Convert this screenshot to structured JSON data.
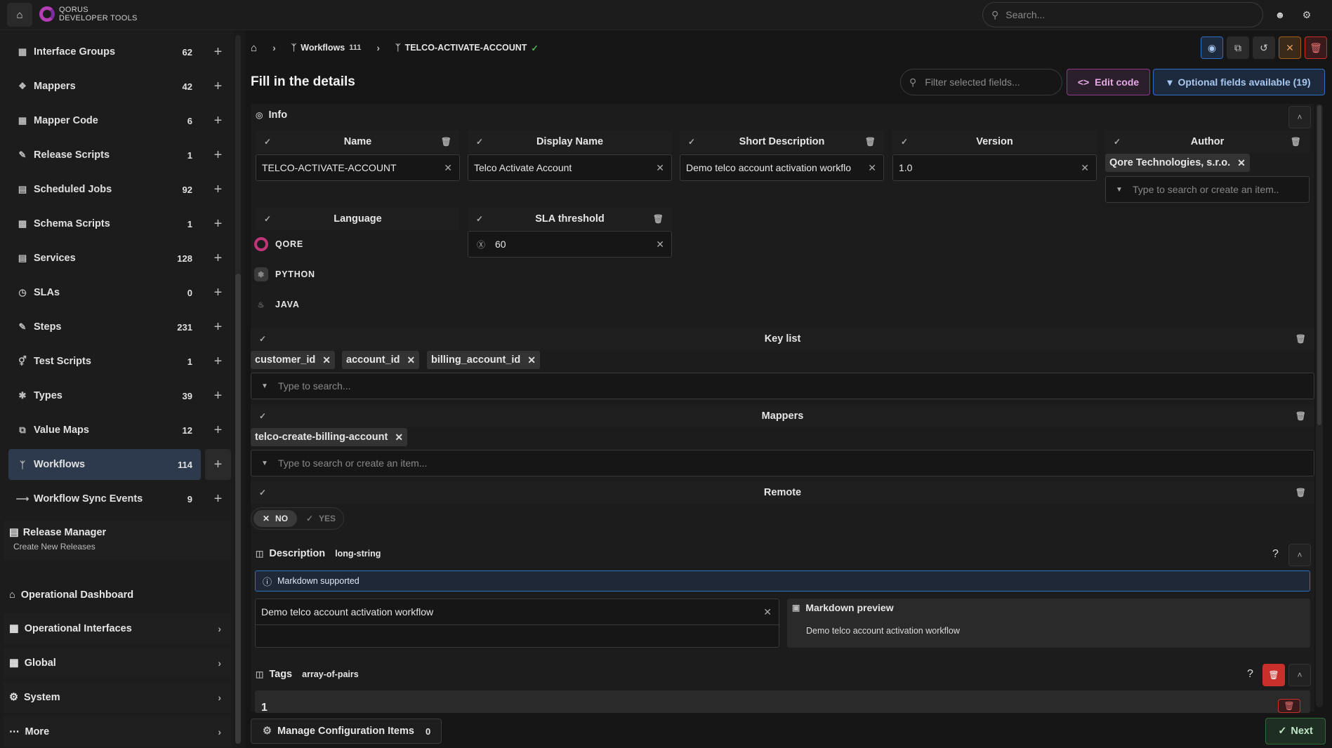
{
  "brand": {
    "line1": "QORUS",
    "line2": "DEVELOPER TOOLS"
  },
  "search": {
    "placeholder": "Search..."
  },
  "sidebar": {
    "items": [
      {
        "label": "Interface Groups",
        "count": "62"
      },
      {
        "label": "Mappers",
        "count": "42"
      },
      {
        "label": "Mapper Code",
        "count": "6"
      },
      {
        "label": "Release Scripts",
        "count": "1"
      },
      {
        "label": "Scheduled Jobs",
        "count": "92"
      },
      {
        "label": "Schema Scripts",
        "count": "1"
      },
      {
        "label": "Services",
        "count": "128"
      },
      {
        "label": "SLAs",
        "count": "0"
      },
      {
        "label": "Steps",
        "count": "231"
      },
      {
        "label": "Test Scripts",
        "count": "1"
      },
      {
        "label": "Types",
        "count": "39"
      },
      {
        "label": "Value Maps",
        "count": "12"
      },
      {
        "label": "Workflows",
        "count": "114"
      },
      {
        "label": "Workflow Sync Events",
        "count": "9"
      }
    ],
    "release_manager": {
      "title": "Release Manager",
      "subtitle": "Create New Releases"
    },
    "sections": [
      "Operational Dashboard",
      "Operational Interfaces",
      "Global",
      "System",
      "More"
    ]
  },
  "breadcrumb": {
    "section": "Workflows",
    "section_count": "111",
    "current": "TELCO-ACTIVATE-ACCOUNT"
  },
  "page": {
    "title": "Fill in the details"
  },
  "toolbar": {
    "filter_placeholder": "Filter selected fields...",
    "edit_code": "Edit code",
    "optional_fields": "Optional fields available (19)"
  },
  "info": {
    "title": "Info",
    "fields": {
      "name_label": "Name",
      "name_value": "TELCO-ACTIVATE-ACCOUNT",
      "display_label": "Display Name",
      "display_value": "Telco Activate Account",
      "short_label": "Short Description",
      "short_value": "Demo telco account activation workflo",
      "version_label": "Version",
      "version_value": "1.0",
      "author_label": "Author",
      "author_tag": "Qore Technologies, s.r.o.",
      "author_placeholder": "Type to search or create an item..",
      "language_label": "Language",
      "languages": [
        "QORE",
        "PYTHON",
        "JAVA"
      ],
      "sla_label": "SLA threshold",
      "sla_value": "60"
    }
  },
  "keylist": {
    "label": "Key list",
    "tags": [
      "customer_id",
      "account_id",
      "billing_account_id"
    ],
    "placeholder": "Type to search..."
  },
  "mappers": {
    "label": "Mappers",
    "tags": [
      "telco-create-billing-account"
    ],
    "placeholder": "Type to search or create an item..."
  },
  "remote": {
    "label": "Remote",
    "no": "NO",
    "yes": "YES"
  },
  "description": {
    "label": "Description",
    "type": "long-string",
    "info": "Markdown supported",
    "value": "Demo telco account activation workflow",
    "preview_title": "Markdown preview",
    "preview_text": "Demo telco account activation workflow"
  },
  "tags_section": {
    "label": "Tags",
    "type": "array-of-pairs",
    "item_index": "1"
  },
  "footer": {
    "manage_label": "Manage Configuration Items",
    "manage_count": "0",
    "next": "Next"
  },
  "colors": {
    "accent_blue": "#2f6fc4",
    "accent_purple": "#b53eb5",
    "success_green": "#2b6e3a",
    "danger_red": "#c9302c"
  }
}
